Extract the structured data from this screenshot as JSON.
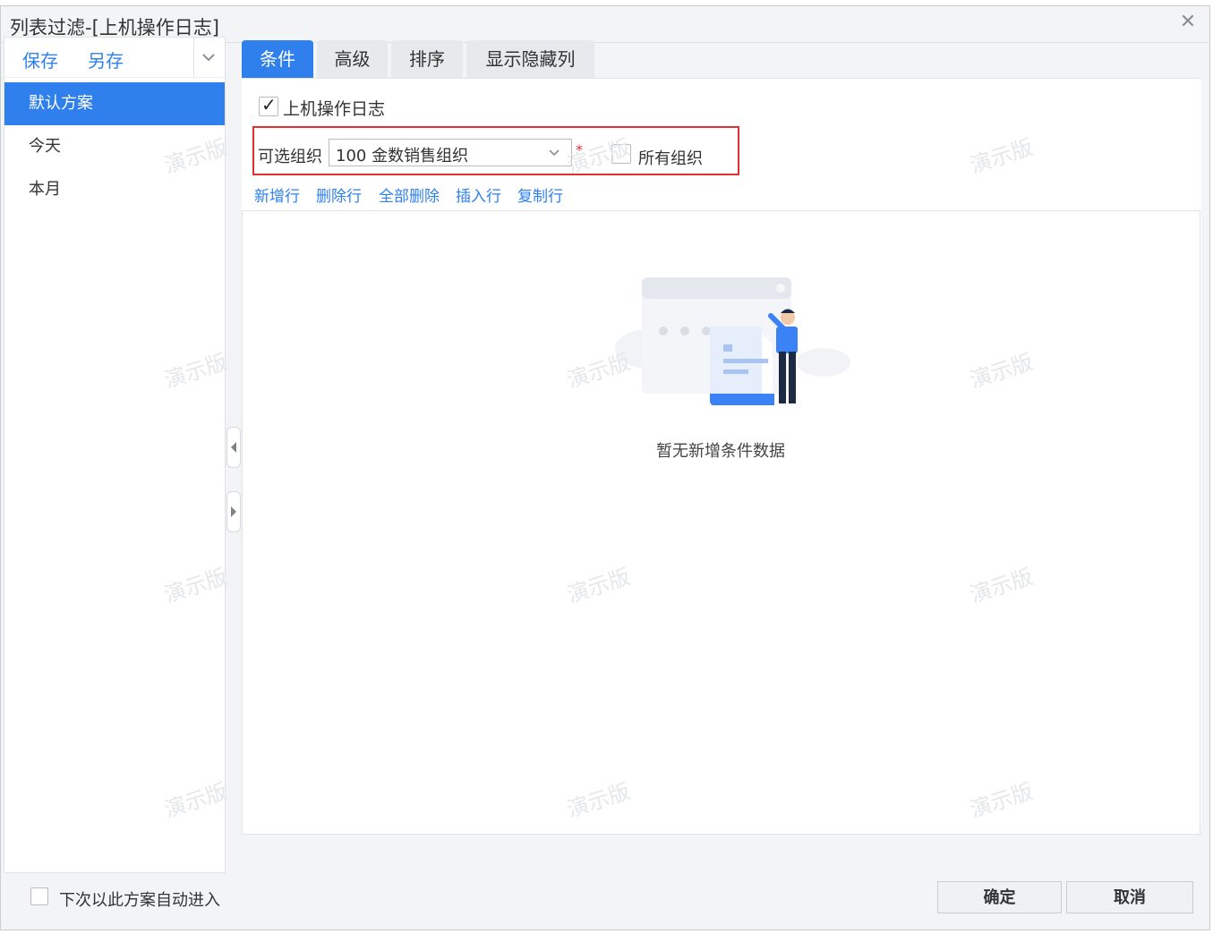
{
  "window": {
    "title": "列表过滤-[上机操作日志]",
    "close_icon": "close-icon"
  },
  "left_panel": {
    "save_label": "保存",
    "save_as_label": "另存",
    "schemes": [
      "默认方案",
      "今天",
      "本月"
    ],
    "active_scheme": "默认方案",
    "auto_enter_label": "下次以此方案自动进入",
    "auto_enter_checked": false
  },
  "tabs": [
    {
      "label": "条件",
      "active": true
    },
    {
      "label": "高级",
      "active": false
    },
    {
      "label": "排序",
      "active": false
    },
    {
      "label": "显示隐藏列",
      "active": false
    }
  ],
  "condition": {
    "entity_label": "上机操作日志",
    "entity_checked": true,
    "org_label": "可选组织",
    "org_value": "100 金数销售组织",
    "required_mark": "*",
    "all_orgs_label": "所有组织",
    "all_orgs_checked": false
  },
  "row_actions": [
    "新增行",
    "删除行",
    "全部删除",
    "插入行",
    "复制行"
  ],
  "empty_state": {
    "text": "暂无新增条件数据"
  },
  "watermark_text": "演示版",
  "footer": {
    "ok_label": "确定",
    "cancel_label": "取消"
  },
  "colors": {
    "accent": "#2f80ed",
    "highlight": "#e03131"
  }
}
